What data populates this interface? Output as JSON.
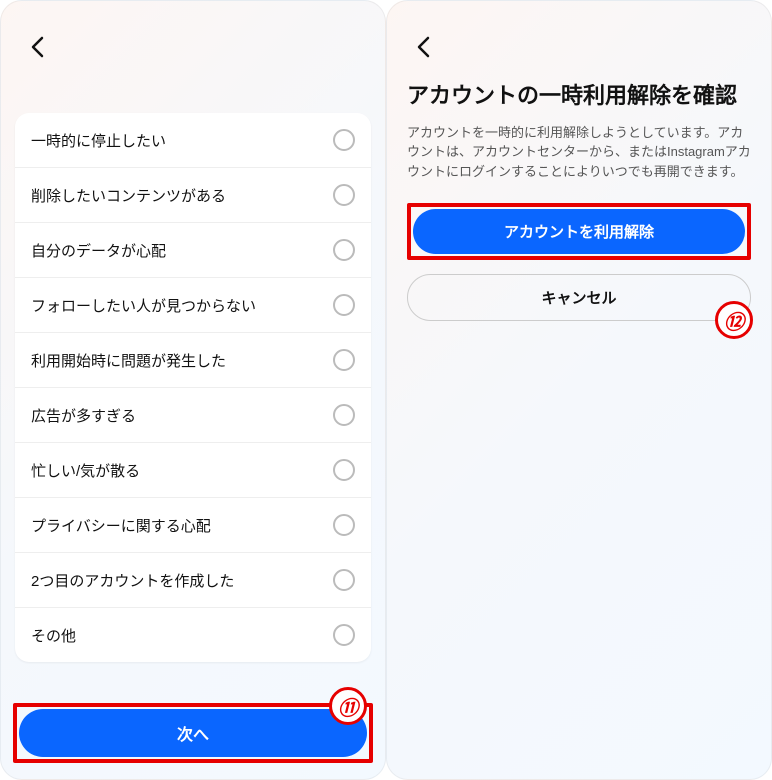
{
  "left": {
    "options": [
      "一時的に停止したい",
      "削除したいコンテンツがある",
      "自分のデータが心配",
      "フォローしたい人が見つからない",
      "利用開始時に問題が発生した",
      "広告が多すぎる",
      "忙しい/気が散る",
      "プライバシーに関する心配",
      "2つ目のアカウントを作成した",
      "その他"
    ],
    "next_button": "次へ",
    "badge": "⑪"
  },
  "right": {
    "title": "アカウントの一時利用解除を確認",
    "description": "アカウントを一時的に利用解除しようとしています。アカウントは、アカウントセンターから、またはInstagramアカウントにログインすることによりいつでも再開できます。",
    "confirm_button": "アカウントを利用解除",
    "cancel_button": "キャンセル",
    "badge": "⑫"
  }
}
